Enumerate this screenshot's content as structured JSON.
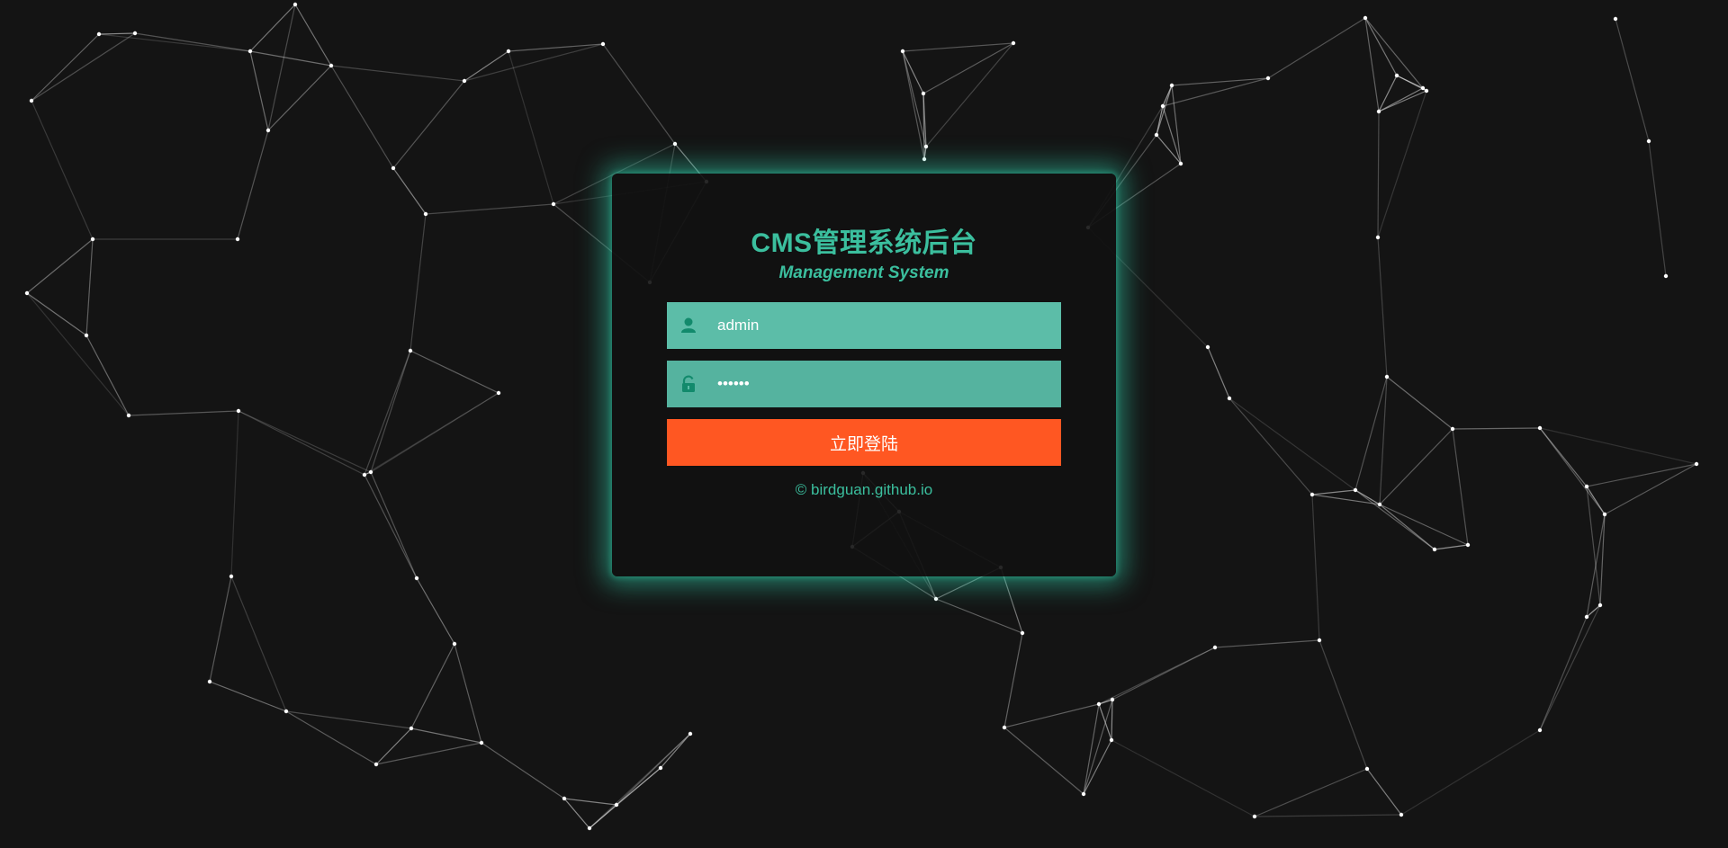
{
  "login": {
    "title": "CMS管理系统后台",
    "subtitle": "Management System",
    "username_value": "admin",
    "password_value": "••••••",
    "submit_label": "立即登陆",
    "copyright": "© birdguan.github.io"
  },
  "icons": {
    "username": "user-icon",
    "password": "lock-icon"
  },
  "colors": {
    "background": "#141414",
    "accent": "#3bbf9e",
    "input_bg": "#5bbda7",
    "button": "#ff5722",
    "network_lines": "#d8d8d8"
  }
}
